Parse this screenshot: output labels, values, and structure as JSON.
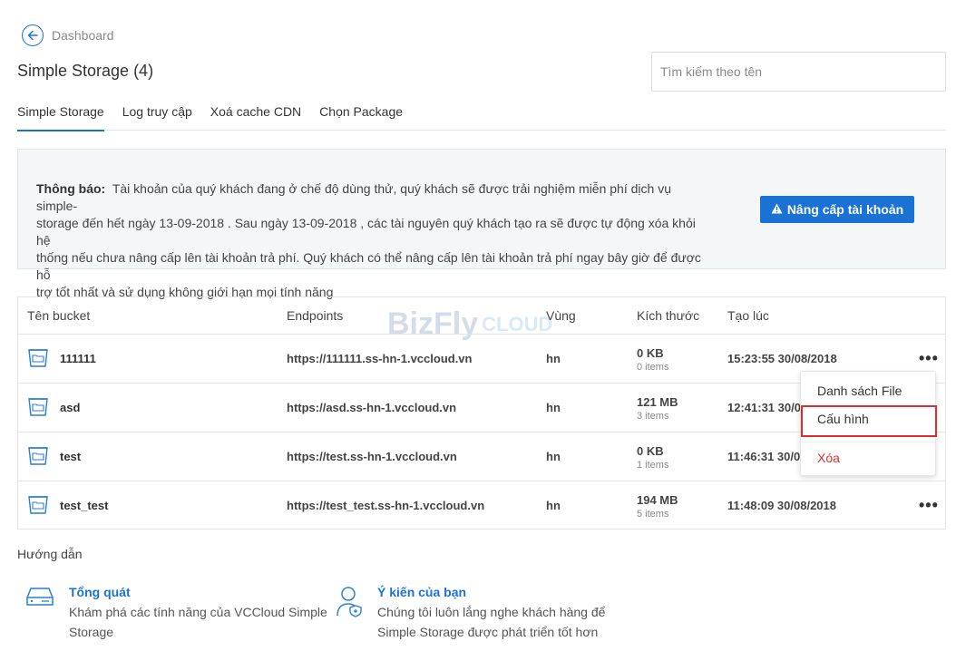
{
  "nav": {
    "back_label": "Dashboard"
  },
  "header": {
    "title": "Simple Storage (4)",
    "search_placeholder": "Tìm kiếm theo tên"
  },
  "tabs": [
    {
      "label": "Simple Storage",
      "active": true
    },
    {
      "label": "Log truy cập",
      "active": false
    },
    {
      "label": "Xoá cache CDN",
      "active": false
    },
    {
      "label": "Chọn Package",
      "active": false
    }
  ],
  "notice": {
    "prefix": "Thông báo:",
    "line1": "Tài khoản của quý khách đang ở chế độ dùng thử, quý khách sẽ được trải nghiệm miễn phí dịch vụ simple-",
    "line2": "storage đến hết ngày 13-09-2018 . Sau ngày 13-09-2018 , các tài nguyên quý khách tạo ra sẽ được tự động xóa khỏi hệ",
    "line3": "thống nếu chưa nâng cấp lên tài khoản trả phí. Quý khách có thể nâng cấp lên tài khoản trả phí ngay bây giờ để được hỗ",
    "line4": "trợ tốt nhất và sử dụng không giới hạn mọi tính năng",
    "button_label": "Nâng cấp tài khoản"
  },
  "table": {
    "headers": {
      "name": "Tên bucket",
      "endpoint": "Endpoints",
      "region": "Vùng",
      "size": "Kích thước",
      "created": "Tạo lúc"
    },
    "rows": [
      {
        "name": "111111",
        "endpoint": "https://111111.ss-hn-1.vccloud.vn",
        "region": "hn",
        "size": "0 KB",
        "items": "0 items",
        "created": "15:23:55 30/08/2018"
      },
      {
        "name": "asd",
        "endpoint": "https://asd.ss-hn-1.vccloud.vn",
        "region": "hn",
        "size": "121 MB",
        "items": "3 items",
        "created": "12:41:31 30/0"
      },
      {
        "name": "test",
        "endpoint": "https://test.ss-hn-1.vccloud.vn",
        "region": "hn",
        "size": "0 KB",
        "items": "1 items",
        "created": "11:46:31 30/0"
      },
      {
        "name": "test_test",
        "endpoint": "https://test_test.ss-hn-1.vccloud.vn",
        "region": "hn",
        "size": "194 MB",
        "items": "5 items",
        "created": "11:48:09 30/08/2018"
      }
    ],
    "more_glyph": "•••"
  },
  "watermark": {
    "biz": "BizFly",
    "cloud": "CLOUD"
  },
  "dropdown": {
    "items": [
      "Danh sách File",
      "Cấu hình",
      "Xóa"
    ]
  },
  "guide": {
    "title": "Hướng dẫn",
    "overview": {
      "heading": "Tổng quát",
      "desc1": "Khám phá các tính năng của VCCloud Simple",
      "desc2": "Storage"
    },
    "feedback": {
      "heading": "Ý kiến của bạn",
      "desc1": "Chúng tôi luôn lắng nghe khách hàng để",
      "desc2": "Simple Storage được phát triển tốt hơn"
    }
  },
  "colors": {
    "accent": "#1a73d4",
    "danger": "#d9302c"
  }
}
